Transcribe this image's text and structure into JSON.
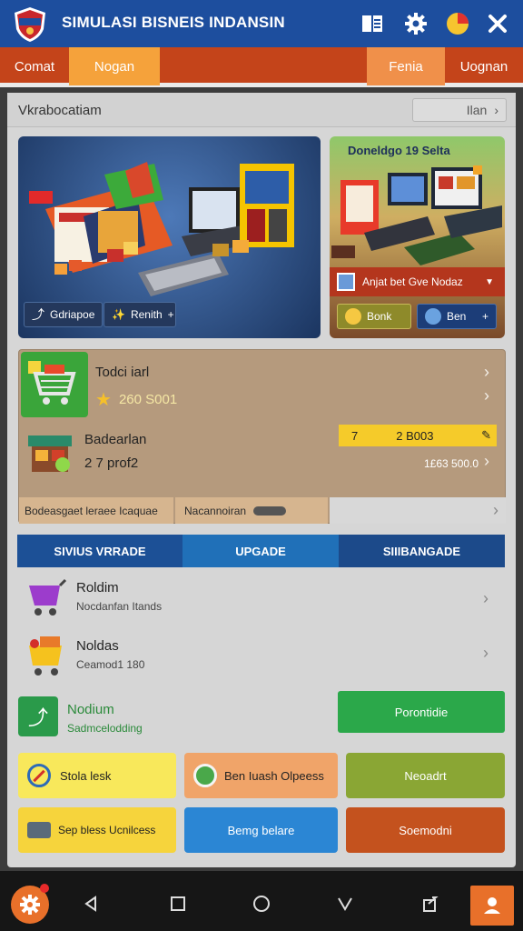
{
  "app": {
    "title": "SIMULASI BISNEIS INDANSIN"
  },
  "top_icons": [
    "book-icon",
    "gear-icon",
    "pie-chart-icon",
    "tools-icon"
  ],
  "tabs": [
    {
      "label": "Comat"
    },
    {
      "label": "Nogan"
    },
    {
      "label": "Fenia"
    },
    {
      "label": "Uognan"
    }
  ],
  "section": {
    "title": "Vkrabocatiam",
    "link_label": "Ilan"
  },
  "banners": {
    "left": {
      "button1": "Gdriapoe",
      "button2": "Renith"
    },
    "right": {
      "title": "Doneldgo 19  Selta",
      "caption": "Anjat bet Gve Nodaz",
      "button1": "Bonk",
      "button2": "Ben"
    }
  },
  "stats": {
    "row1": {
      "title": "Todci iarl",
      "value": "260 S001"
    },
    "row2": {
      "title": "Badearlan",
      "value": "2 7 prof2",
      "badge_left": "7",
      "badge_right": "2 B003",
      "amount": "1£63 500.0"
    },
    "footer": {
      "left": "Bodeasgaet leraee Icaquae",
      "right": "Nacannoiran"
    }
  },
  "upgrade_tabs": [
    {
      "label": "SIVIUS VRRADE",
      "color": "#1c5096"
    },
    {
      "label": "UPGADE",
      "color": "#2070b8"
    },
    {
      "label": "SIIIBANGADE",
      "color": "#1c4a8a"
    }
  ],
  "list": [
    {
      "title": "Roldim",
      "subtitle": "Nocdanfan Itands"
    },
    {
      "title": "Noldas",
      "subtitle": "Ceamod1 180"
    }
  ],
  "premium": {
    "title": "Nodium",
    "subtitle": "Sadmcelodding",
    "button": "Porontidie"
  },
  "actions": [
    {
      "label": "Stola lesk",
      "color": "#f8e85b",
      "icon": "no-entry-icon"
    },
    {
      "label": "Ben Iuash Olpeess",
      "color": "#f0a469",
      "icon": "globe-icon"
    },
    {
      "label": "Neoadrt",
      "color": "#8aa634",
      "icon": ""
    },
    {
      "label": "Sep bless Ucnilcess",
      "color": "#f6d43c",
      "icon": "wallet-icon"
    },
    {
      "label": "Bemg belare",
      "color": "#2b86d4",
      "icon": ""
    },
    {
      "label": "Soemodni",
      "color": "#c4521e",
      "icon": ""
    }
  ],
  "nav": [
    "gear-icon",
    "back-icon",
    "home-square-icon",
    "circle-icon",
    "recent-icon",
    "share-icon",
    "profile-icon"
  ]
}
